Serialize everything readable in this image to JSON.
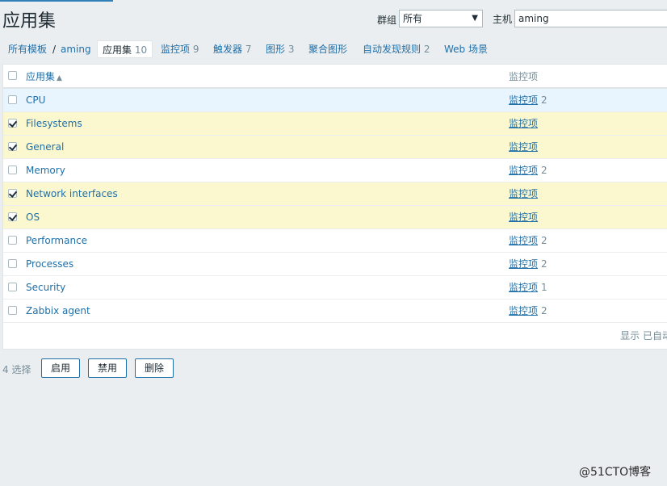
{
  "page": {
    "title": "应用集"
  },
  "filters": {
    "group_label": "群组",
    "group_value": "所有",
    "host_label": "主机",
    "host_value": "aming"
  },
  "breadcrumb": {
    "all_templates": "所有模板",
    "separator": "/",
    "host": "aming",
    "tabs": [
      {
        "label": "应用集",
        "count": "10",
        "active": true
      },
      {
        "label": "监控项",
        "count": "9"
      },
      {
        "label": "触发器",
        "count": "7"
      },
      {
        "label": "图形",
        "count": "3"
      },
      {
        "label": "聚合图形",
        "count": ""
      },
      {
        "label": "自动发现规则",
        "count": "2"
      },
      {
        "label": "Web 场景",
        "count": ""
      }
    ]
  },
  "table": {
    "columns": {
      "name": "应用集",
      "items": "监控项"
    },
    "sort_indicator": "▲",
    "rows": [
      {
        "name": "CPU",
        "items_label": "监控项",
        "count": "2",
        "checked": false,
        "state": "hover"
      },
      {
        "name": "Filesystems",
        "items_label": "监控项",
        "count": "",
        "checked": true,
        "state": "selected"
      },
      {
        "name": "General",
        "items_label": "监控项",
        "count": "",
        "checked": true,
        "state": "selected"
      },
      {
        "name": "Memory",
        "items_label": "监控项",
        "count": "2",
        "checked": false,
        "state": ""
      },
      {
        "name": "Network interfaces",
        "items_label": "监控项",
        "count": "",
        "checked": true,
        "state": "selected"
      },
      {
        "name": "OS",
        "items_label": "监控项",
        "count": "",
        "checked": true,
        "state": "selected"
      },
      {
        "name": "Performance",
        "items_label": "监控项",
        "count": "2",
        "checked": false,
        "state": ""
      },
      {
        "name": "Processes",
        "items_label": "监控项",
        "count": "2",
        "checked": false,
        "state": ""
      },
      {
        "name": "Security",
        "items_label": "监控项",
        "count": "1",
        "checked": false,
        "state": ""
      },
      {
        "name": "Zabbix agent",
        "items_label": "监控项",
        "count": "2",
        "checked": false,
        "state": ""
      }
    ],
    "footer": "显示 已自动"
  },
  "actions": {
    "selected_count": "4 选择",
    "enable": "启用",
    "disable": "禁用",
    "delete": "删除"
  },
  "watermark": "@51CTO博客"
}
